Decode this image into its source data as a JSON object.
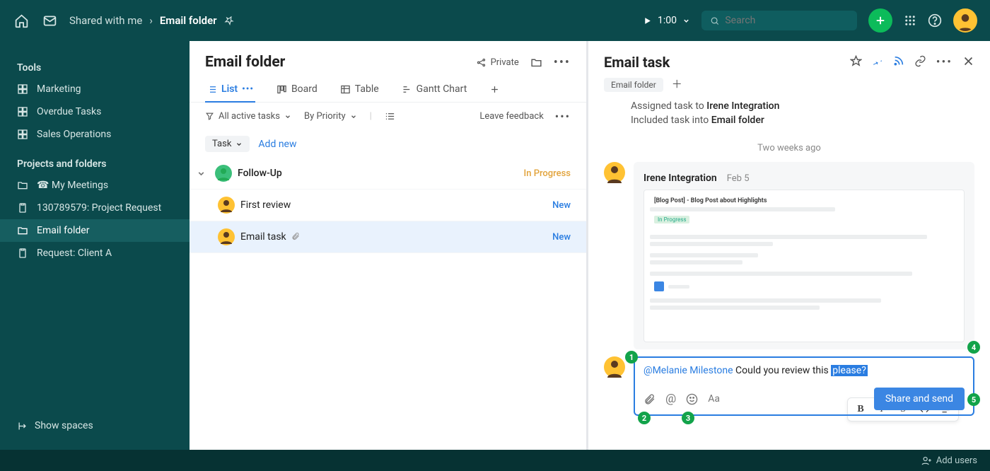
{
  "topbar": {
    "breadcrumb_parent": "Shared with me",
    "breadcrumb_current": "Email folder",
    "timer": "1:00",
    "search_placeholder": "Search"
  },
  "sidebar": {
    "section_tools": "Tools",
    "tools": [
      {
        "label": "Marketing"
      },
      {
        "label": "Overdue Tasks"
      },
      {
        "label": "Sales Operations"
      }
    ],
    "section_projects": "Projects and folders",
    "projects": [
      {
        "label": "☎ My Meetings",
        "icon": "folder"
      },
      {
        "label": "130789579: Project Request",
        "icon": "clipboard"
      },
      {
        "label": "Email folder",
        "icon": "folder",
        "active": true
      },
      {
        "label": "Request: Client A",
        "icon": "clipboard"
      }
    ],
    "show_spaces": "Show spaces"
  },
  "center": {
    "title": "Email folder",
    "privacy": "Private",
    "tabs": {
      "list": "List",
      "board": "Board",
      "table": "Table",
      "gantt": "Gantt Chart"
    },
    "filters": {
      "all_active": "All active tasks",
      "by_priority": "By Priority",
      "feedback": "Leave feedback"
    },
    "task_chip": "Task",
    "add_new": "Add new",
    "tasks": {
      "group": {
        "name": "Follow-Up",
        "status": "In Progress"
      },
      "children": [
        {
          "name": "First review",
          "status": "New"
        },
        {
          "name": "Email task",
          "status": "New",
          "has_attachment": true,
          "selected": true
        }
      ]
    }
  },
  "right": {
    "title": "Email task",
    "crumb_chip": "Email folder",
    "activity": {
      "assigned_prefix": "Assigned task to ",
      "assigned_name": "Irene Integration",
      "included_prefix": "Included task into ",
      "included_name": "Email folder",
      "timeago": "Two weeks ago"
    },
    "comment": {
      "author": "Irene Integration",
      "date": "Feb 5"
    },
    "compose": {
      "mention": "@Melanie Milestone",
      "text_mid": " Could you review this ",
      "text_hl": "please?",
      "aa": "Aa",
      "send": "Share and send"
    },
    "fmt_labels": {
      "b": "B",
      "i": "I",
      "s": "S"
    },
    "badges": [
      "1",
      "2",
      "3",
      "4",
      "5"
    ]
  },
  "bottom": {
    "add_users": "Add users"
  }
}
